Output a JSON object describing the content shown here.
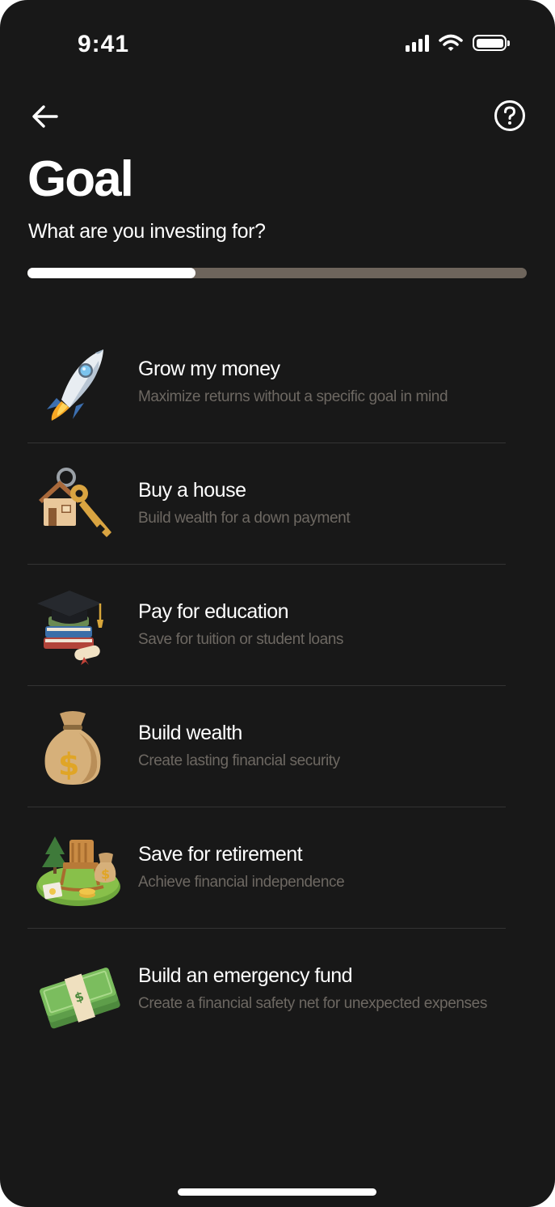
{
  "status_bar": {
    "time": "9:41"
  },
  "header": {
    "title": "Goal",
    "subtitle": "What are you investing for?"
  },
  "progress": {
    "fraction": 0.336
  },
  "goals": [
    {
      "icon": "rocket-icon",
      "title": "Grow my money",
      "description": "Maximize returns without a specific goal in mind"
    },
    {
      "icon": "house-key-icon",
      "title": "Buy a house",
      "description": "Build wealth for a down payment"
    },
    {
      "icon": "graduation-books-icon",
      "title": "Pay for education",
      "description": "Save for tuition or student loans"
    },
    {
      "icon": "money-bag-icon",
      "title": "Build wealth",
      "description": "Create lasting financial security"
    },
    {
      "icon": "retirement-chair-icon",
      "title": "Save for retirement",
      "description": "Achieve financial independence"
    },
    {
      "icon": "cash-stack-icon",
      "title": "Build an emergency fund",
      "description": "Create a financial safety net for unexpected expenses"
    }
  ]
}
